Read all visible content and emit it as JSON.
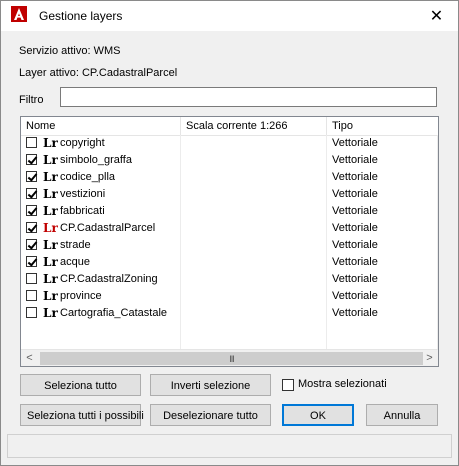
{
  "window": {
    "title": "Gestione layers",
    "close_label": "✕"
  },
  "info": {
    "service_line": "Servizio attivo: WMS",
    "layer_line": "Layer attivo: CP.CadastralParcel"
  },
  "filter": {
    "label": "Filtro",
    "value": ""
  },
  "grid": {
    "columns": [
      "Nome",
      "Scala corrente 1:266",
      "Tipo"
    ],
    "rows": [
      {
        "checked": false,
        "icon": "Lr",
        "name": "copyright",
        "scale": "",
        "type": "Vettoriale",
        "active": false
      },
      {
        "checked": true,
        "icon": "Lr",
        "name": "simbolo_graffa",
        "scale": "",
        "type": "Vettoriale",
        "active": false
      },
      {
        "checked": true,
        "icon": "Lr",
        "name": "codice_plla",
        "scale": "",
        "type": "Vettoriale",
        "active": false
      },
      {
        "checked": true,
        "icon": "Lr",
        "name": "vestizioni",
        "scale": "",
        "type": "Vettoriale",
        "active": false
      },
      {
        "checked": true,
        "icon": "Lr",
        "name": "fabbricati",
        "scale": "",
        "type": "Vettoriale",
        "active": false
      },
      {
        "checked": true,
        "icon": "Lr",
        "name": "CP.CadastralParcel",
        "scale": "",
        "type": "Vettoriale",
        "active": true
      },
      {
        "checked": true,
        "icon": "Lr",
        "name": "strade",
        "scale": "",
        "type": "Vettoriale",
        "active": false
      },
      {
        "checked": true,
        "icon": "Lr",
        "name": "acque",
        "scale": "",
        "type": "Vettoriale",
        "active": false
      },
      {
        "checked": false,
        "icon": "Lr",
        "name": "CP.CadastralZoning",
        "scale": "",
        "type": "Vettoriale",
        "active": false
      },
      {
        "checked": false,
        "icon": "Lr",
        "name": "province",
        "scale": "",
        "type": "Vettoriale",
        "active": false
      },
      {
        "checked": false,
        "icon": "Lr",
        "name": "Cartografia_Catastale",
        "scale": "",
        "type": "Vettoriale",
        "active": false
      }
    ],
    "scroll": {
      "left_arrow": "<",
      "right_arrow": ">",
      "thumb_grip": "III"
    }
  },
  "buttons": {
    "select_all": "Seleziona tutto",
    "invert_selection": "Inverti selezione",
    "show_selected": "Mostra selezionati",
    "show_selected_checked": false,
    "select_all_possible": "Seleziona tutti i possibili",
    "deselect_all": "Deselezionare tutto",
    "ok": "OK",
    "cancel": "Annulla"
  },
  "colors": {
    "active_layer_icon": "#c00000",
    "app_icon": "#c00000",
    "default_button_border": "#0078d7"
  },
  "status": {
    "text": ""
  }
}
